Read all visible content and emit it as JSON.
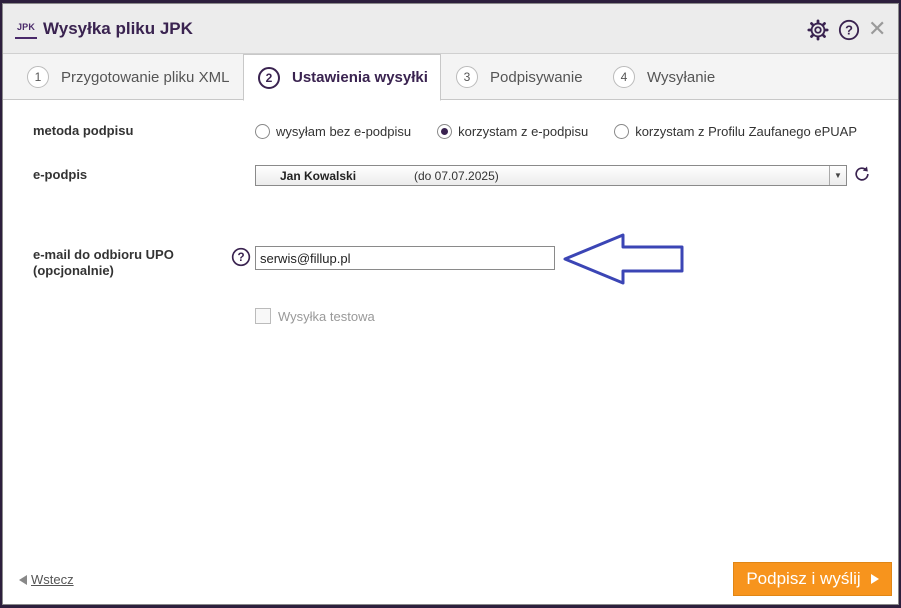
{
  "window": {
    "logo_text": "JPK",
    "title": "Wysyłka pliku JPK",
    "icons": [
      "gear-icon",
      "help-icon",
      "close-icon"
    ]
  },
  "tabs": [
    {
      "num": "1",
      "label": "Przygotowanie pliku XML",
      "active": false
    },
    {
      "num": "2",
      "label": "Ustawienia wysyłki",
      "active": true
    },
    {
      "num": "3",
      "label": "Podpisywanie",
      "active": false
    },
    {
      "num": "4",
      "label": "Wysyłanie",
      "active": false
    }
  ],
  "form": {
    "signature_method": {
      "label": "metoda podpisu",
      "options": [
        {
          "label": "wysyłam bez e-podpisu",
          "selected": false
        },
        {
          "label": "korzystam z e-podpisu",
          "selected": true
        },
        {
          "label": "korzystam z Profilu Zaufanego ePUAP",
          "selected": false
        }
      ]
    },
    "esignature": {
      "label": "e-podpis",
      "selected_name": "Jan Kowalski",
      "selected_validity": "(do 07.07.2025)"
    },
    "email": {
      "label_line1": "e-mail do odbioru UPO",
      "label_line2": "(opcjonalnie)",
      "value": "serwis@fillup.pl"
    },
    "test_send": {
      "label": "Wysyłka testowa",
      "checked": false,
      "disabled": true
    }
  },
  "footer": {
    "back_label": "Wstecz",
    "submit_label": "Podpisz i wyślij"
  },
  "colors": {
    "accent": "#3a2350",
    "submit": "#f7941d",
    "annotation_arrow": "#3b45b5"
  }
}
